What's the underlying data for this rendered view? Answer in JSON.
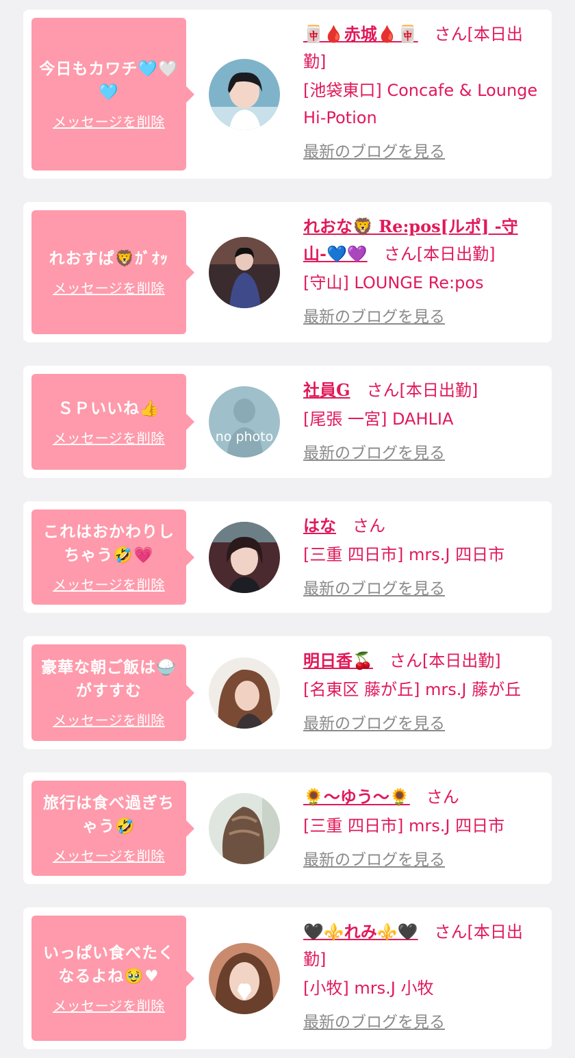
{
  "cards": [
    {
      "message": "今日もカワチ🩵🤍🩵",
      "delete_label": "メッセージを削除",
      "name": "🀄🩸赤城🩸🀄",
      "suffix": "さん[本日出勤]",
      "shop": "[池袋東口] Concafe & Lounge Hi-Potion",
      "blog_label": "最新のブログを見る"
    },
    {
      "message": "れおすぱ🦁ｶﾞｵｯ",
      "delete_label": "メッセージを削除",
      "name": "れおな🦁 Re:pos[ルポ] -守山-💙💜",
      "suffix": "さん[本日出勤]",
      "shop": "[守山] LOUNGE Re:pos",
      "blog_label": "最新のブログを見る"
    },
    {
      "message": "ＳＰいいね👍",
      "delete_label": "メッセージを削除",
      "name": "社員G",
      "suffix": "さん[本日出勤]",
      "shop": "[尾張 一宮] DAHLIA",
      "blog_label": "最新のブログを見る",
      "avatar_text": "no photo"
    },
    {
      "message": "これはおかわりしちゃう🤣💗",
      "delete_label": "メッセージを削除",
      "name": "はな",
      "suffix": "さん",
      "shop": "[三重 四日市] mrs.J 四日市",
      "blog_label": "最新のブログを見る"
    },
    {
      "message": "豪華な朝ご飯は🍚がすすむ",
      "delete_label": "メッセージを削除",
      "name": "明日香🍒",
      "suffix": "さん[本日出勤]",
      "shop": "[名東区 藤が丘] mrs.J 藤が丘",
      "blog_label": "最新のブログを見る"
    },
    {
      "message": "旅行は食べ過ぎちゃう🤣",
      "delete_label": "メッセージを削除",
      "name": "🌻〜ゆう〜🌻",
      "suffix": "さん",
      "shop": "[三重 四日市] mrs.J 四日市",
      "blog_label": "最新のブログを見る"
    },
    {
      "message": "いっぱい食べたくなるよね🥹♥",
      "delete_label": "メッセージを削除",
      "name": "🖤⚜️れみ⚜️🖤",
      "suffix": "さん[本日出勤]",
      "shop": "[小牧] mrs.J 小牧",
      "blog_label": "最新のブログを見る"
    }
  ],
  "colors": {
    "background": "#f1f1f3",
    "bubble": "#fe9aab",
    "accent": "#e0195a",
    "muted": "#8a8a8a"
  }
}
